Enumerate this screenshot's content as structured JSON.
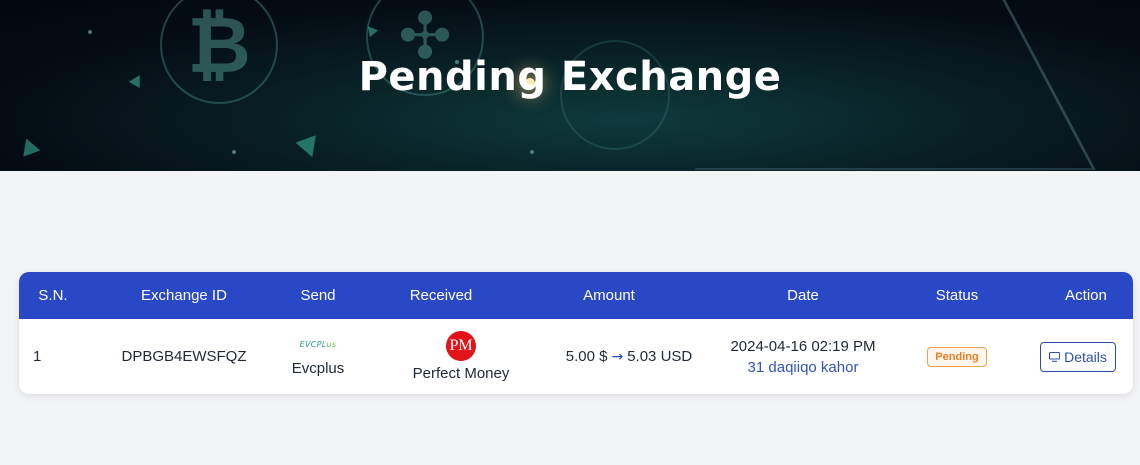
{
  "hero": {
    "title": "Pending Exchange"
  },
  "table": {
    "headers": {
      "sn": "S.N.",
      "exchange_id": "Exchange ID",
      "send": "Send",
      "received": "Received",
      "amount": "Amount",
      "date": "Date",
      "status": "Status",
      "action": "Action"
    },
    "rows": [
      {
        "sn": "1",
        "exchange_id": "DPBGB4EWSFQZ",
        "send": {
          "logo_text": "EVCPL",
          "logo_accent": "us",
          "name": "Evcplus"
        },
        "received": {
          "logo_text": "PM",
          "name": "Perfect Money"
        },
        "amount": {
          "from": "5.00 $",
          "to": "5.03 USD"
        },
        "date": {
          "datetime": "2024-04-16 02:19 PM",
          "relative": "31 daqiiqo kahor"
        },
        "status": "Pending",
        "action": "Details"
      }
    ]
  },
  "colors": {
    "header_bg": "#2948c6",
    "status_pending": "#ef7d23",
    "link": "#2f55b8"
  }
}
